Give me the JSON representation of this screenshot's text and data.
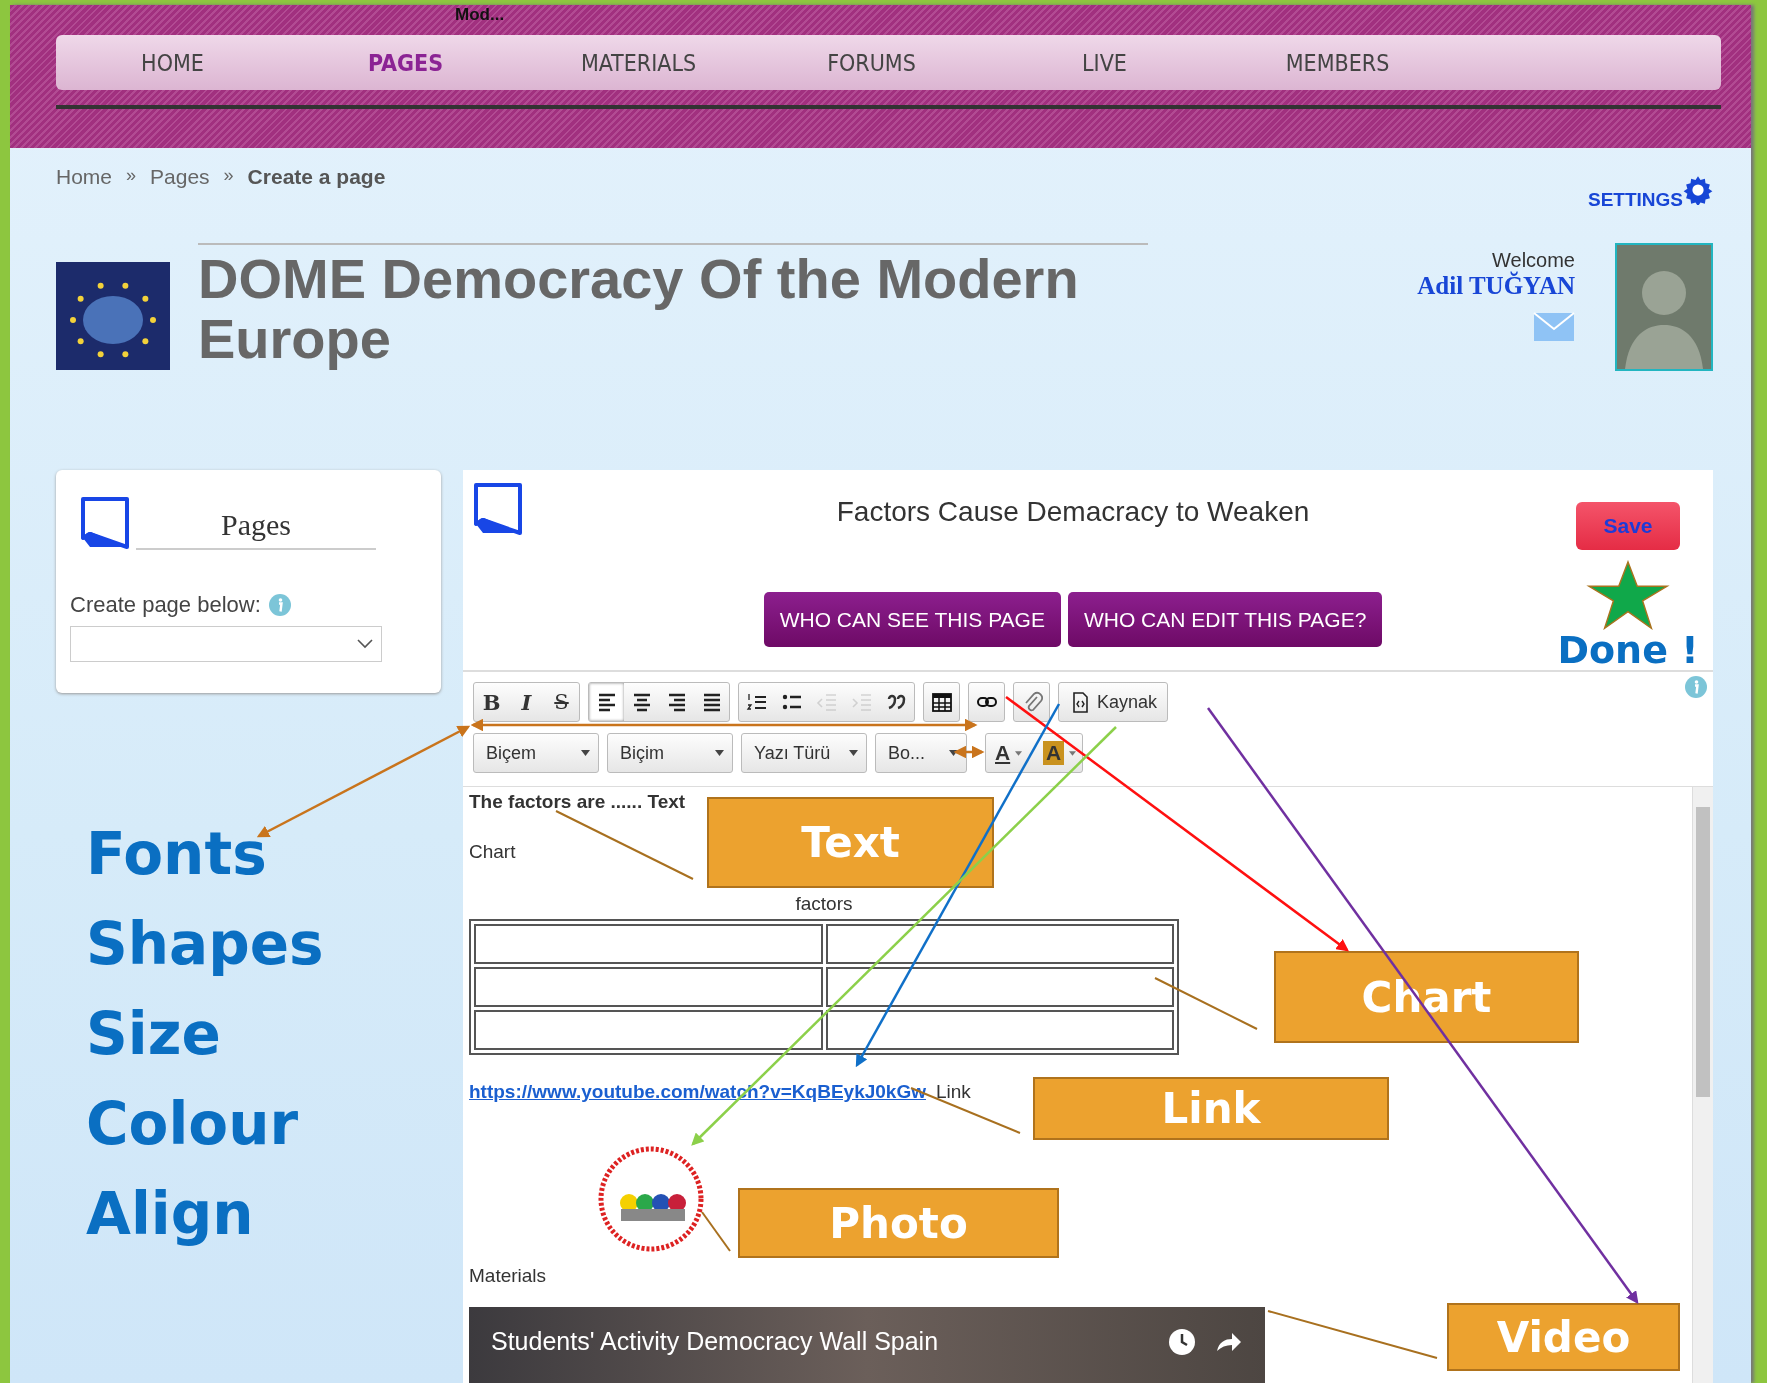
{
  "top_cut_text": "Mod...",
  "nav": [
    {
      "label": "HOME",
      "selected": false
    },
    {
      "label": "PAGES",
      "selected": true
    },
    {
      "label": "MATERIALS",
      "selected": false
    },
    {
      "label": "FORUMS",
      "selected": false
    },
    {
      "label": "LIVE",
      "selected": false
    },
    {
      "label": "MEMBERS",
      "selected": false
    }
  ],
  "breadcrumb": [
    {
      "label": "Home",
      "kind": "link"
    },
    {
      "label": "»",
      "kind": "separator"
    },
    {
      "label": "Pages",
      "kind": "link"
    },
    {
      "label": "»",
      "kind": "separator"
    },
    {
      "label": "Create a page",
      "kind": "current"
    }
  ],
  "settings": "SETTINGS",
  "site_title": "DOME Democracy Of the Modern Europe",
  "user": {
    "welcome": "Welcome",
    "name": "Adil TUĞYAN"
  },
  "sidebar": {
    "title": "Pages",
    "field_label": "Create page below:"
  },
  "editor": {
    "page_title": "Factors Cause Demacracy to Weaken",
    "save": "Save",
    "permissions": [
      "WHO CAN SEE THIS PAGE",
      "WHO CAN EDIT THIS PAGE?"
    ],
    "toolbar_groups": [
      [
        {
          "kind": "bold",
          "glyph": "B",
          "selected": false,
          "disabled": false
        },
        {
          "kind": "italic",
          "glyph": "I",
          "selected": false,
          "disabled": false
        },
        {
          "kind": "strike",
          "glyph": "S",
          "selected": false,
          "disabled": false
        }
      ],
      [
        {
          "kind": "align-left",
          "selected": true,
          "disabled": false
        },
        {
          "kind": "align-center",
          "selected": false,
          "disabled": false
        },
        {
          "kind": "align-right",
          "selected": false,
          "disabled": false
        },
        {
          "kind": "justify",
          "selected": false,
          "disabled": false
        }
      ],
      [
        {
          "kind": "ordered-list",
          "selected": false,
          "disabled": false
        },
        {
          "kind": "bullet-list",
          "selected": false,
          "disabled": false
        },
        {
          "kind": "outdent",
          "selected": false,
          "disabled": true
        },
        {
          "kind": "indent",
          "selected": false,
          "disabled": true
        },
        {
          "kind": "quote",
          "selected": false,
          "disabled": false
        }
      ],
      [
        {
          "kind": "table",
          "selected": false,
          "disabled": false
        }
      ],
      [
        {
          "kind": "link",
          "selected": false,
          "disabled": false
        }
      ],
      [
        {
          "kind": "attach",
          "selected": false,
          "disabled": false
        }
      ],
      [
        {
          "kind": "source",
          "label": "Kaynak",
          "selected": false,
          "disabled": false
        }
      ]
    ],
    "dropdowns": [
      "Biçem",
      "Biçim",
      "Yazı Türü",
      "Bo..."
    ],
    "color_tools": [
      {
        "kind": "text-color",
        "glyph": "A"
      },
      {
        "kind": "bg-color",
        "glyph": "A"
      }
    ],
    "content": {
      "text_line": "The factors are ...... Text",
      "chart_label": "Chart",
      "table_caption": "factors",
      "link_url": "https://www.youtube.com/watch?v=KqBEykJ0kGw",
      "link_after": "Link",
      "materials": "Materials",
      "video_title": "Students' Activity Democracy Wall Spain"
    }
  },
  "annotations": {
    "side_labels": [
      "Fonts",
      "Shapes",
      "Size",
      "Colour",
      "Align"
    ],
    "done": "Done !",
    "callouts": [
      {
        "label": "Text",
        "kind": "text"
      },
      {
        "label": "Chart",
        "kind": "chart"
      },
      {
        "label": "Link",
        "kind": "link"
      },
      {
        "label": "Photo",
        "kind": "photo"
      },
      {
        "label": "Video",
        "kind": "video"
      }
    ]
  }
}
